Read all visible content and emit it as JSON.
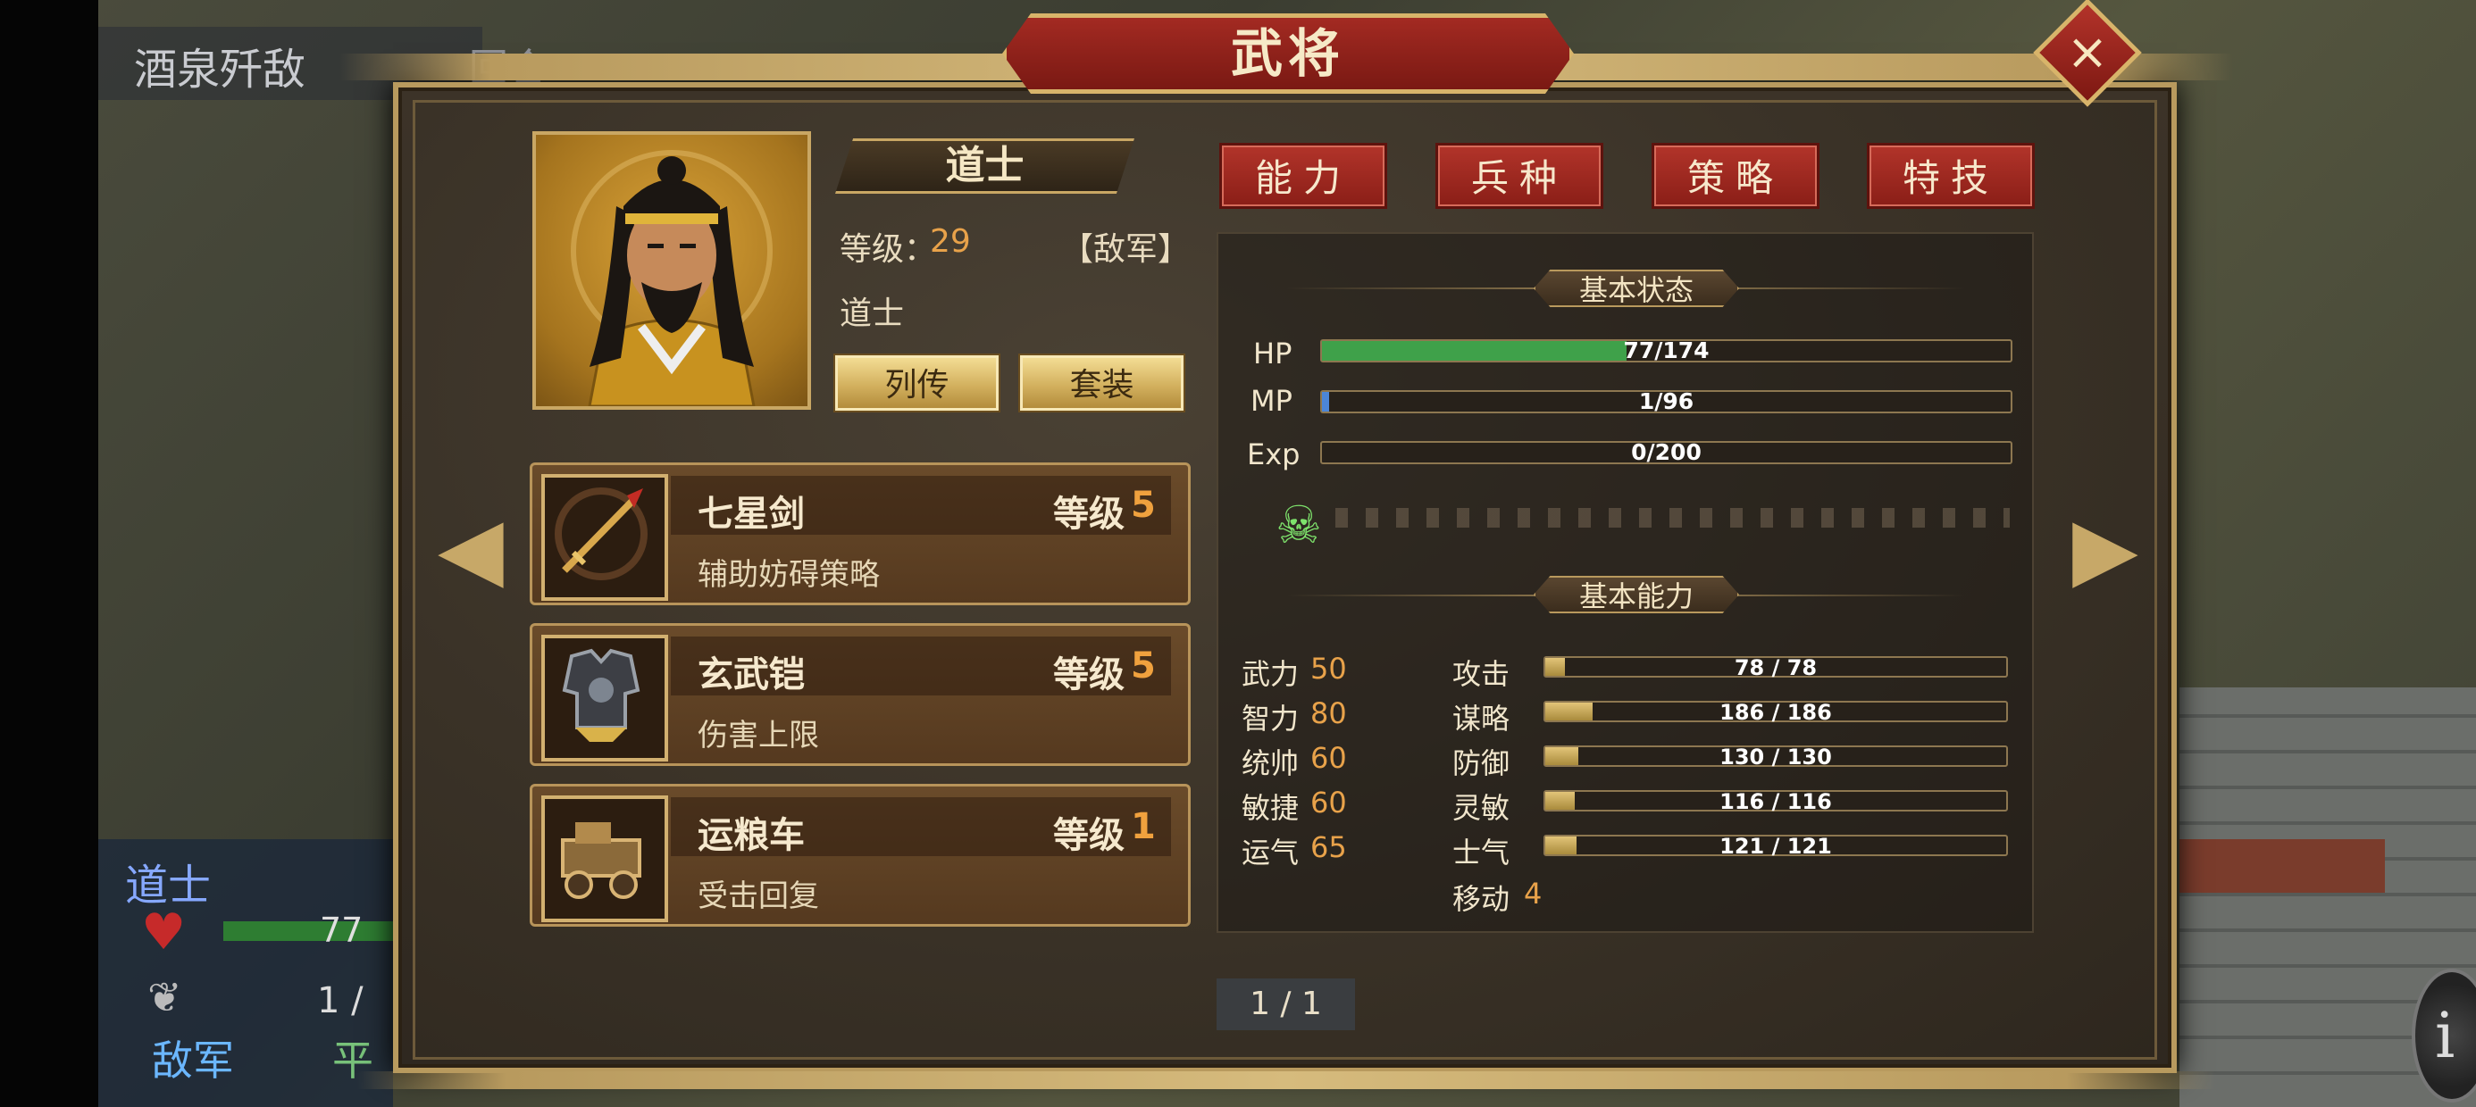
{
  "background": {
    "hud_top_title": "酒泉歼敌",
    "hud_top_partial": "回合",
    "hud_unit_name": "道士",
    "hud_hp_partial": "77",
    "hud_mp_partial": "1 /",
    "hud_side": "敌军",
    "hud_mode_partial": "平",
    "info_button": "i"
  },
  "dialog": {
    "title": "武将",
    "close_icon": "×",
    "nav_left_icon": "◀",
    "nav_right_icon": "▶"
  },
  "general": {
    "name": "道士",
    "level_label": "等级：",
    "level_value": "29",
    "faction": "【敌军】",
    "class": "道士",
    "buttons": {
      "biography": "列传",
      "outfit": "套装"
    }
  },
  "equipment": [
    {
      "name": "七星剑",
      "level_label": "等级",
      "level": "5",
      "desc": "辅助妨碍策略",
      "icon": "sword-icon"
    },
    {
      "name": "玄武铠",
      "level_label": "等级",
      "level": "5",
      "desc": "伤害上限",
      "icon": "armor-icon"
    },
    {
      "name": "运粮车",
      "level_label": "等级",
      "level": "1",
      "desc": "受击回复",
      "icon": "cart-icon"
    }
  ],
  "tabs": [
    "能力",
    "兵种",
    "策略",
    "特技"
  ],
  "basic_status": {
    "title": "基本状态",
    "hp": {
      "label": "HP",
      "text": "77/174",
      "value": 77,
      "max": 174,
      "color": "#3fa14a"
    },
    "mp": {
      "label": "MP",
      "text": "1/96",
      "value": 1,
      "max": 96,
      "color": "#4c86d8"
    },
    "exp": {
      "label": "Exp",
      "text": "0/200",
      "value": 0,
      "max": 200,
      "color": "#c9a94e"
    },
    "status_icon": "skull-icon"
  },
  "basic_ability": {
    "title": "基本能力",
    "attributes": [
      {
        "name": "武力",
        "value": "50"
      },
      {
        "name": "智力",
        "value": "80"
      },
      {
        "name": "统帅",
        "value": "60"
      },
      {
        "name": "敏捷",
        "value": "60"
      },
      {
        "name": "运气",
        "value": "65"
      }
    ],
    "combat": [
      {
        "name": "攻击",
        "text": "78 / 78",
        "value": 78
      },
      {
        "name": "谋略",
        "text": "186 / 186",
        "value": 186
      },
      {
        "name": "防御",
        "text": "130 / 130",
        "value": 130
      },
      {
        "name": "灵敏",
        "text": "116 / 116",
        "value": 116
      },
      {
        "name": "士气",
        "text": "121 / 121",
        "value": 121
      }
    ],
    "move_label": "移动",
    "move_value": "4"
  },
  "pagination": "1 / 1"
}
